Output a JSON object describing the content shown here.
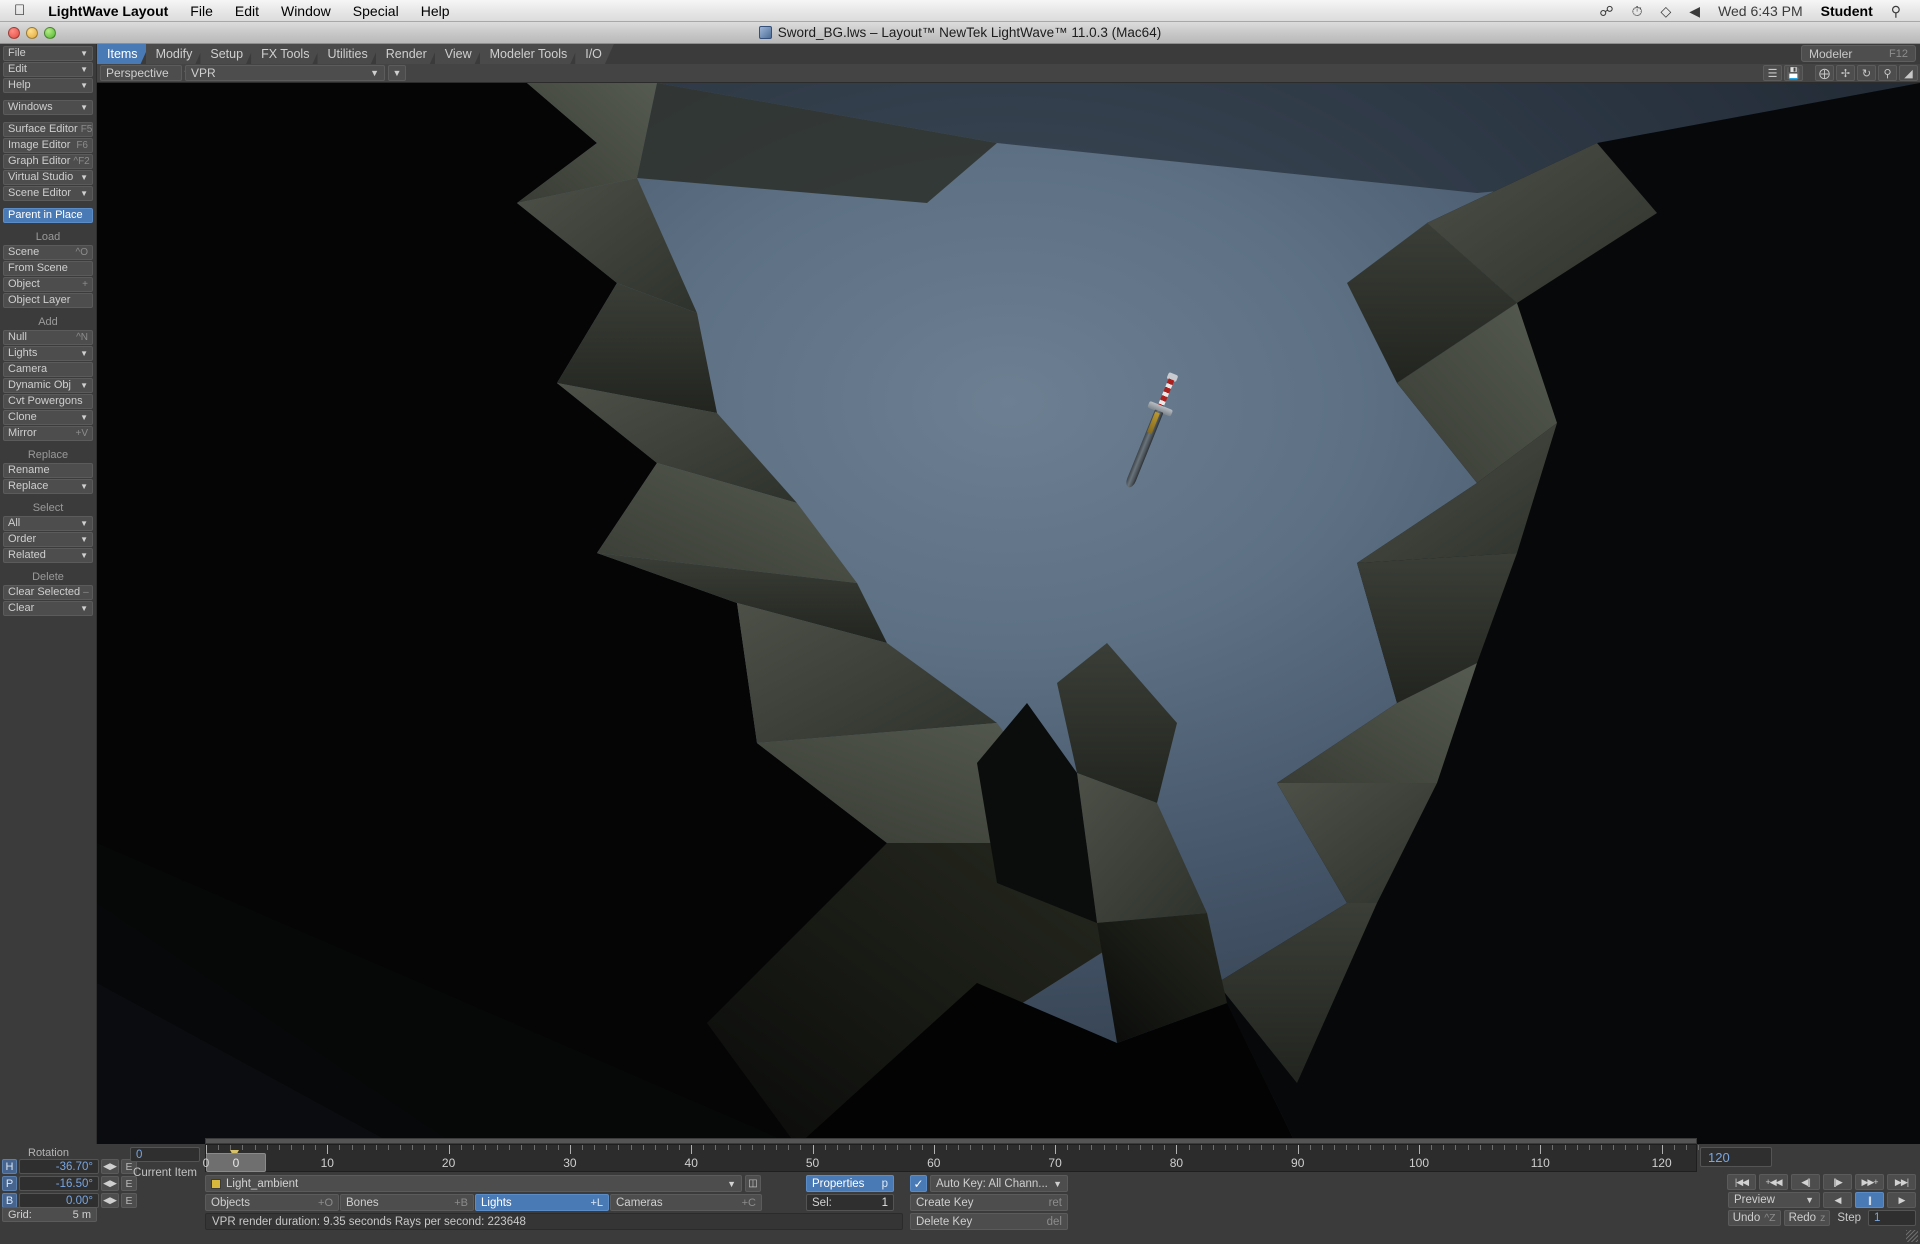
{
  "mac_menubar": {
    "apple_icon": "apple-icon",
    "app_name": "LightWave Layout",
    "menus": [
      "File",
      "Edit",
      "Window",
      "Special",
      "Help"
    ],
    "status_icons": [
      "bluetooth-icon",
      "timemachine-icon",
      "wifi-icon",
      "volume-icon"
    ],
    "clock": "Wed 6:43 PM",
    "user": "Student",
    "search_icon": "spotlight-search-icon"
  },
  "window": {
    "title": "Sword_BG.lws – Layout™ NewTek LightWave™ 11.0.3 (Mac64)",
    "doc_icon": "lightwave-scene-icon"
  },
  "tabs": {
    "items": [
      "Items",
      "Modify",
      "Setup",
      "FX Tools",
      "Utilities",
      "Render",
      "View",
      "Modeler Tools",
      "I/O"
    ],
    "selected": "Items",
    "modeler_button": {
      "label": "Modeler",
      "shortcut": "F12"
    }
  },
  "viewport_header": {
    "view_mode": "Perspective",
    "render_mode": "VPR",
    "icons": [
      "list-icon",
      "save-layout-icon",
      "center-icon",
      "move-icon",
      "rotate-icon",
      "zoom-icon",
      "maximize-icon"
    ]
  },
  "sidebar": {
    "groups": [
      {
        "header": "",
        "items": [
          {
            "label": "File",
            "type": "dropdown"
          },
          {
            "label": "Edit",
            "type": "dropdown"
          },
          {
            "label": "Help",
            "type": "dropdown"
          }
        ]
      },
      {
        "header": "",
        "items": [
          {
            "label": "Windows",
            "type": "dropdown"
          }
        ]
      },
      {
        "header": "",
        "items": [
          {
            "label": "Surface Editor",
            "key": "F5"
          },
          {
            "label": "Image Editor",
            "key": "F6"
          },
          {
            "label": "Graph Editor",
            "key": "^F2"
          },
          {
            "label": "Virtual Studio",
            "type": "dropdown"
          },
          {
            "label": "Scene Editor",
            "type": "dropdown"
          }
        ]
      },
      {
        "header": "",
        "items": [
          {
            "label": "Parent in Place",
            "highlighted": true
          }
        ]
      },
      {
        "header": "Load",
        "items": [
          {
            "label": "Scene",
            "key": "^O"
          },
          {
            "label": "From Scene"
          },
          {
            "label": "Object",
            "key": "+"
          },
          {
            "label": "Object Layer"
          }
        ]
      },
      {
        "header": "Add",
        "items": [
          {
            "label": "Null",
            "key": "^N"
          },
          {
            "label": "Lights",
            "type": "dropdown"
          },
          {
            "label": "Camera"
          },
          {
            "label": "Dynamic Obj",
            "type": "dropdown"
          },
          {
            "label": "Cvt Powergons"
          },
          {
            "label": "Clone",
            "type": "dropdown"
          },
          {
            "label": "Mirror",
            "key": "+V"
          }
        ]
      },
      {
        "header": "Replace",
        "items": [
          {
            "label": "Rename"
          },
          {
            "label": "Replace",
            "type": "dropdown"
          }
        ]
      },
      {
        "header": "Select",
        "items": [
          {
            "label": "All",
            "type": "dropdown"
          },
          {
            "label": "Order",
            "type": "dropdown"
          },
          {
            "label": "Related",
            "type": "dropdown"
          }
        ]
      },
      {
        "header": "Delete",
        "items": [
          {
            "label": "Clear Selected",
            "key": "–"
          },
          {
            "label": "Clear",
            "type": "dropdown"
          }
        ]
      }
    ]
  },
  "transform_panel": {
    "title": "Rotation",
    "rows": [
      {
        "axis": "H",
        "value": "-36.70°"
      },
      {
        "axis": "P",
        "value": "-16.50°"
      },
      {
        "axis": "B",
        "value": "0.00°"
      }
    ],
    "arrow_icon": "nudge-arrows-icon",
    "envelope_label": "E",
    "grid_label": "Grid:",
    "grid_value": "5 m"
  },
  "frame_controls": {
    "current_frame": "0",
    "current_item_label": "Current Item",
    "end_frame": "120"
  },
  "timeline": {
    "marker_frame": "0",
    "tick_labels": [
      "0",
      "10",
      "20",
      "30",
      "40",
      "50",
      "60",
      "70",
      "80",
      "90",
      "100",
      "110",
      "120"
    ],
    "range_start": 0,
    "range_end": 123
  },
  "item_selector": {
    "selected_item": "Light_ambient",
    "swatch_color": "#d7b73c",
    "properties_icon": "item-properties-icon"
  },
  "selection_tabs": [
    {
      "label": "Objects",
      "key": "+O",
      "active": false
    },
    {
      "label": "Bones",
      "key": "+B",
      "active": false
    },
    {
      "label": "Lights",
      "key": "+L",
      "active": true
    },
    {
      "label": "Cameras",
      "key": "+C",
      "active": false
    }
  ],
  "status_text": "VPR render duration: 9.35 seconds  Rays per second: 223648",
  "properties_panel": {
    "properties_label": "Properties",
    "properties_key": "p",
    "sel_label": "Sel:",
    "sel_value": "1"
  },
  "keyframe_panel": {
    "autokey_label": "Auto Key: All Chann...",
    "autokey_checked": true,
    "create_key": {
      "label": "Create Key",
      "key": "ret"
    },
    "delete_key": {
      "label": "Delete Key",
      "key": "del"
    }
  },
  "transport": {
    "buttons": [
      {
        "name": "go-to-start",
        "glyph": "|◀◀"
      },
      {
        "name": "prev-keyframe",
        "glyph": "+◀◀"
      },
      {
        "name": "step-back",
        "glyph": "◀||"
      },
      {
        "name": "step-forward",
        "glyph": "||▶"
      },
      {
        "name": "next-keyframe",
        "glyph": "▶▶+"
      },
      {
        "name": "go-to-end",
        "glyph": "▶▶|"
      }
    ],
    "preview_label": "Preview",
    "play_reverse": "◀",
    "pause": "||",
    "play_forward": "▶",
    "undo": {
      "label": "Undo",
      "key": "^Z"
    },
    "redo": {
      "label": "Redo",
      "key": "z"
    },
    "step_label": "Step",
    "step_value": "1"
  },
  "colors": {
    "accent_blue": "#4a7ab5",
    "panel_bg": "#3b3b3b",
    "button_bg": "#4d4d4d",
    "field_text": "#7aa6e0",
    "sky_top": "#6d7f92",
    "rock_dark": "#2a2d28"
  },
  "scene": {
    "description": "3D cave opening with sword",
    "object": "sword"
  }
}
